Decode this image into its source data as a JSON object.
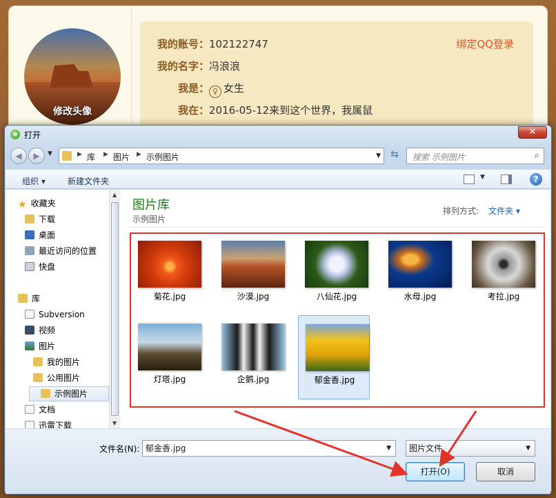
{
  "profile": {
    "avatar_label": "修改头像",
    "account_key": "我的账号：",
    "account_value": "102122747",
    "name_key": "我的名字：",
    "name_value": "冯浪浪",
    "gender_key": "我是：",
    "gender_value": "女生",
    "birth_key": "我在：",
    "birth_value": "2016-05-12来到这个世界，我属鼠",
    "bind_qq": "绑定QQ登录"
  },
  "dialog": {
    "title": "打开",
    "close": "✕",
    "breadcrumbs": [
      "库",
      "图片",
      "示例图片"
    ],
    "search_placeholder": "搜索 示例图片",
    "toolbar": {
      "organize": "组织 ▾",
      "new_folder": "新建文件夹"
    },
    "nav": {
      "favorites": "收藏夹",
      "downloads": "下载",
      "desktop": "桌面",
      "recent": "最近访问的位置",
      "kuaipan": "快盘",
      "libraries": "库",
      "subversion": "Subversion",
      "videos": "视频",
      "pictures": "图片",
      "my_pictures": "我的图片",
      "public_pictures": "公用图片",
      "sample_pictures": "示例图片",
      "documents": "文档",
      "xunlei": "迅雷下载"
    },
    "library_title": "图片库",
    "library_sub": "示例图片",
    "sort_label": "排列方式:",
    "sort_value": "文件夹 ▾",
    "files": [
      "菊花.jpg",
      "沙漠.jpg",
      "八仙花.jpg",
      "水母.jpg",
      "考拉.jpg",
      "灯塔.jpg",
      "企鹅.jpg",
      "郁金香.jpg"
    ],
    "filename_label": "文件名(N):",
    "filename_value": "郁金香.jpg",
    "filetype_value": "图片文件",
    "open_button": "打开(O)",
    "cancel_button": "取消"
  },
  "colors": {
    "annotation": "#e2332a",
    "library_title": "#1e7a1e",
    "link": "#1f5fb8"
  }
}
